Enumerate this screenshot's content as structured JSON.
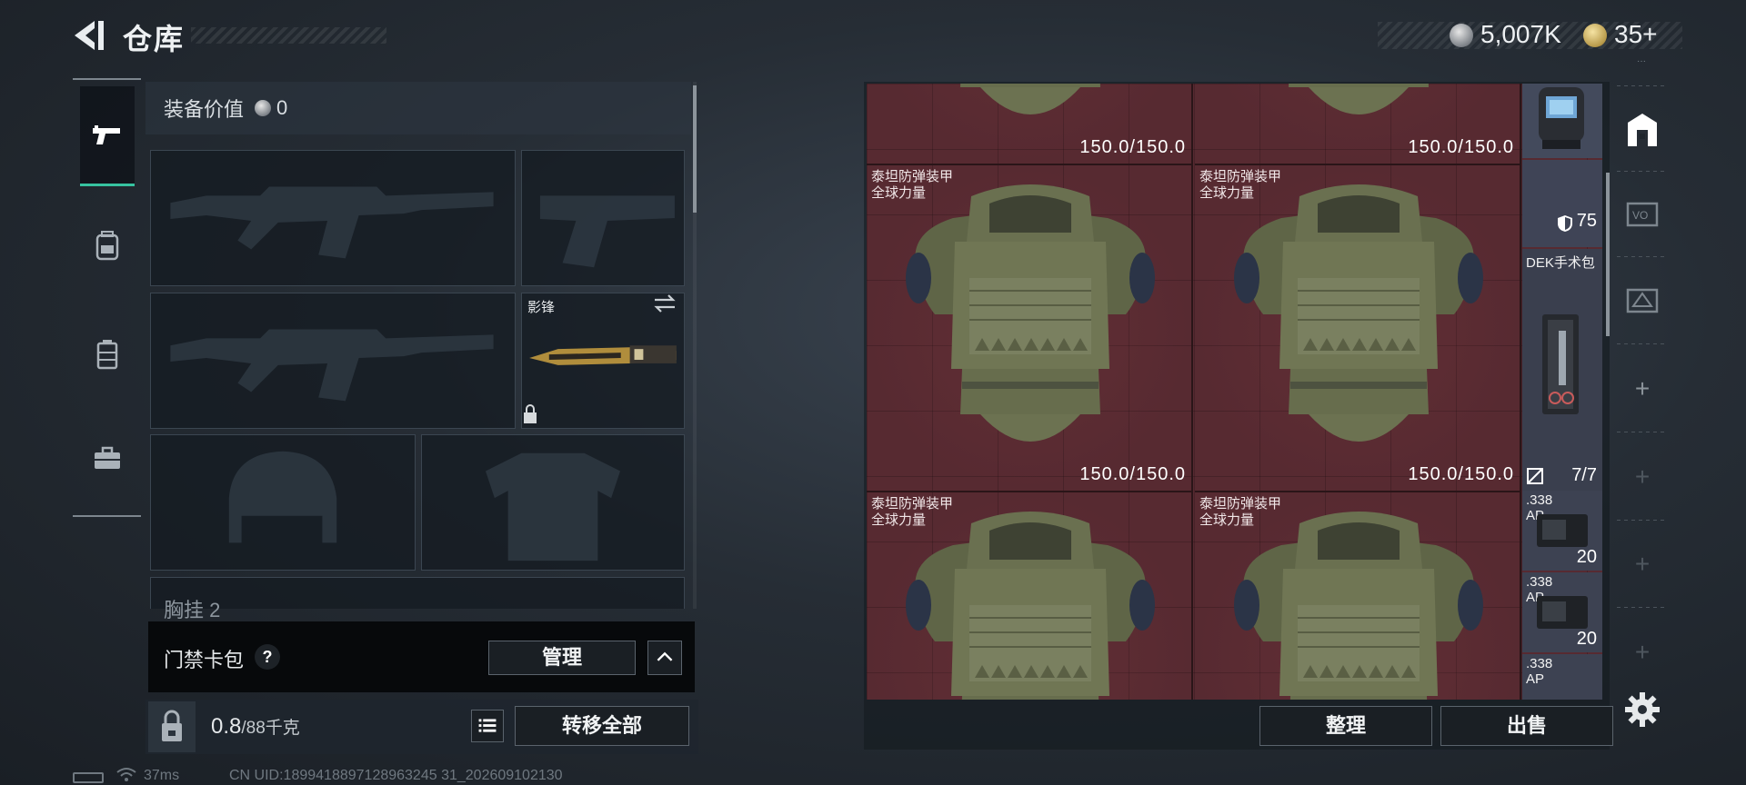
{
  "header": {
    "title": "仓库",
    "money": "5,007K",
    "gold": "35+",
    "tiny": "···"
  },
  "left_rail": {
    "tabs": [
      {
        "name": "tab-weapons",
        "icon": "pistol-icon",
        "active": true
      },
      {
        "name": "tab-backpack",
        "icon": "backpack-icon",
        "active": false
      },
      {
        "name": "tab-rig",
        "icon": "rig-icon",
        "active": false
      },
      {
        "name": "tab-toolbox",
        "icon": "toolbox-icon",
        "active": false
      }
    ]
  },
  "loadout": {
    "equip_value_label": "装备价值",
    "equip_value": "0",
    "melee_slot_name": "影锋",
    "chest_rig_label": "胸挂",
    "chest_rig_count": "2",
    "access_card_label": "门禁卡包",
    "help_label": "?",
    "manage_label": "管理",
    "weight_current": "0.8",
    "weight_max": "/88千克",
    "transfer_all_label": "转移全部"
  },
  "stash": {
    "armor_items": [
      {
        "name": "",
        "durability": "150.0/150.0"
      },
      {
        "name": "",
        "durability": "150.0/150.0"
      },
      {
        "name": "泰坦防弹装甲\n全球力量",
        "durability": "150.0/150.0"
      },
      {
        "name": "泰坦防弹装甲\n全球力量",
        "durability": "150.0/150.0"
      },
      {
        "name": "泰坦防弹装甲\n全球力量",
        "durability": ""
      },
      {
        "name": "泰坦防弹装甲\n全球力量",
        "durability": ""
      }
    ],
    "helmet_armor_value": "75",
    "medkit_name": "DEK手术包",
    "medkit_uses": "7/7",
    "ammo": [
      {
        "name": ".338\nAP",
        "count": "20"
      },
      {
        "name": ".338\nAP",
        "count": "20"
      },
      {
        "name": ".338\nAP",
        "count": ""
      }
    ],
    "sort_label": "整理",
    "sell_label": "出售"
  },
  "status": {
    "ping": "37ms",
    "uid": "CN UID:1899418897128963245 31_202609102130"
  },
  "colors": {
    "accent": "#37c3a0",
    "stash_bg": "#572a31",
    "armor_green": "#6f7552"
  }
}
